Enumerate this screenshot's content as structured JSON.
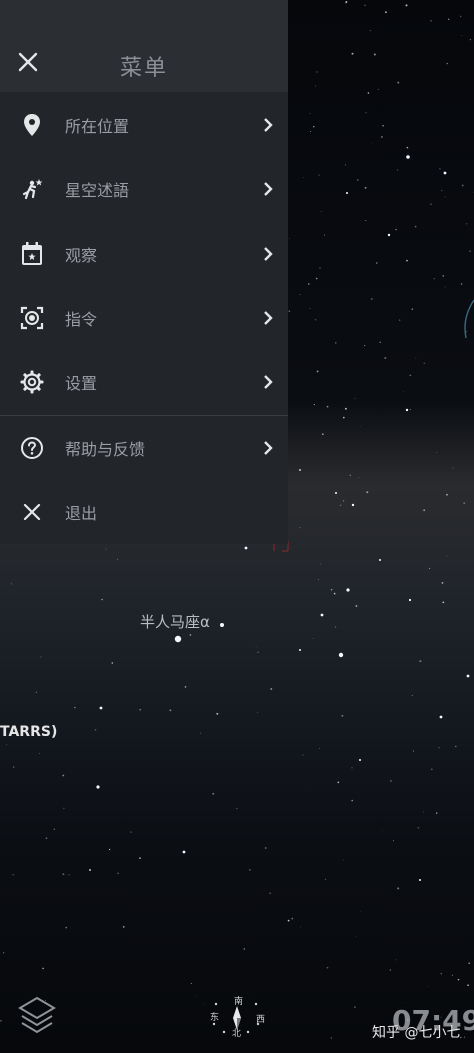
{
  "drawer": {
    "title": "菜单",
    "items": [
      {
        "label": "所在位置",
        "icon": "location-pin-icon"
      },
      {
        "label": "星空述語",
        "icon": "running-star-icon"
      },
      {
        "label": "观察",
        "icon": "calendar-icon"
      },
      {
        "label": "指令",
        "icon": "scan-target-icon"
      },
      {
        "label": "设置",
        "icon": "gear-icon"
      },
      {
        "label": "帮助与反馈",
        "icon": "help-icon"
      },
      {
        "label": "退出",
        "icon": "close-icon"
      }
    ]
  },
  "sky": {
    "star_label": "半人马座α",
    "partial_label": "TARRS)"
  },
  "compass": {
    "south": "南",
    "east": "东",
    "west": "西",
    "north": "北"
  },
  "clock": "07:49",
  "watermark": "知乎 @七小七",
  "colors": {
    "drawer_bg": "#222529",
    "header_bg": "#2b2e32",
    "text": "#9a9ea4",
    "sky": "#05070b"
  }
}
